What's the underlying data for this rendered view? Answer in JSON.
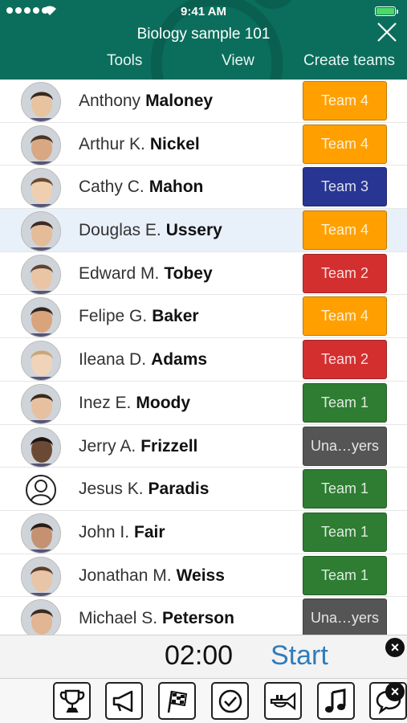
{
  "status_bar": {
    "time": "9:41 AM"
  },
  "header": {
    "title": "Biology sample 101",
    "nav": {
      "tools": "Tools",
      "view": "View",
      "create_teams": "Create teams"
    }
  },
  "team_colors": {
    "Team 1": "#2e7d32",
    "Team 2": "#d32f2f",
    "Team 3": "#283593",
    "Team 4": "#ffa000",
    "Una…yers": "#555555"
  },
  "students": [
    {
      "first": "Anthony",
      "last": "Maloney",
      "team": "Team 4"
    },
    {
      "first": "Arthur K.",
      "last": "Nickel",
      "team": "Team 4"
    },
    {
      "first": "Cathy  C.",
      "last": "Mahon",
      "team": "Team 3"
    },
    {
      "first": "Douglas E.",
      "last": "Ussery",
      "team": "Team 4"
    },
    {
      "first": "Edward M.",
      "last": "Tobey",
      "team": "Team 2"
    },
    {
      "first": "Felipe G.",
      "last": "Baker",
      "team": "Team 4"
    },
    {
      "first": "Ileana D.",
      "last": "Adams",
      "team": "Team 2"
    },
    {
      "first": "Inez E.",
      "last": "Moody",
      "team": "Team 1"
    },
    {
      "first": "Jerry A.",
      "last": "Frizzell",
      "team": "Una…yers"
    },
    {
      "first": "Jesus K.",
      "last": "Paradis",
      "team": "Team 1"
    },
    {
      "first": "John I.",
      "last": "Fair",
      "team": "Team 1"
    },
    {
      "first": "Jonathan M.",
      "last": "Weiss",
      "team": "Team 1"
    },
    {
      "first": "Michael S.",
      "last": "Peterson",
      "team": "Una…yers"
    }
  ],
  "timer": {
    "value": "02:00",
    "start_label": "Start"
  },
  "toolbar": {
    "icons": [
      "trophy-icon",
      "megaphone-icon",
      "checkered-flag-icon",
      "checkmark-icon",
      "trumpet-icon",
      "music-note-icon",
      "speech-bubble-icon"
    ]
  }
}
